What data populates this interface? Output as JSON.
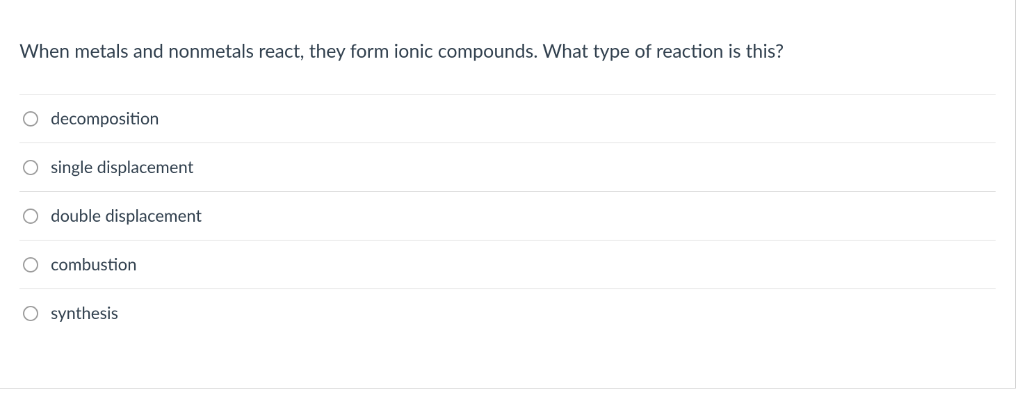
{
  "question": {
    "text": "When metals and nonmetals react, they form ionic compounds. What type of reaction is this?"
  },
  "options": [
    {
      "label": "decomposition"
    },
    {
      "label": "single displacement"
    },
    {
      "label": "double displacement"
    },
    {
      "label": "combustion"
    },
    {
      "label": "synthesis"
    }
  ]
}
